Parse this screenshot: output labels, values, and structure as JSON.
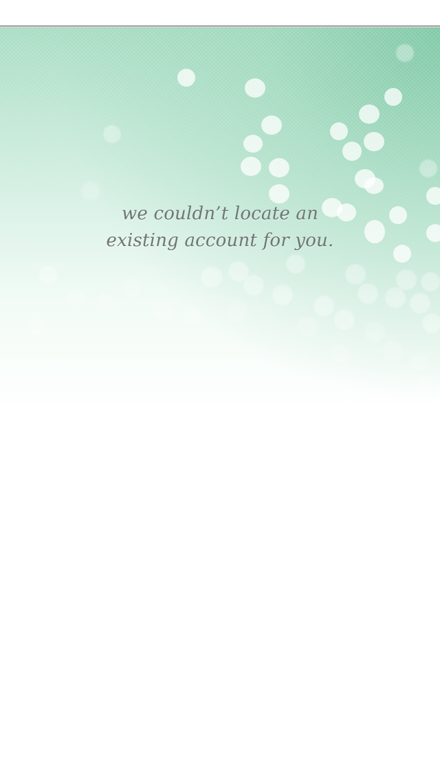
{
  "message": {
    "line1": "we couldn’t locate an",
    "line2": "existing account for you."
  },
  "colors": {
    "background": "#ffffff",
    "gradient_top": "#a6dcc2",
    "gradient_accent": "#76c4a0",
    "text": "#6e7673"
  }
}
